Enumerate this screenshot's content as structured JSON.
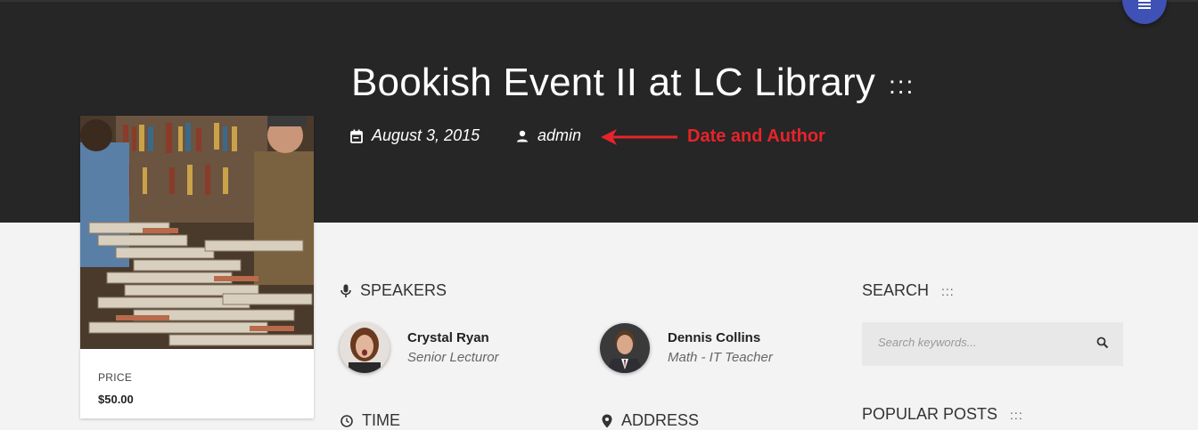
{
  "event": {
    "title": "Bookish Event II at LC Library",
    "title_dots": ":::",
    "date": "August 3, 2015",
    "author": "admin"
  },
  "annotation": {
    "text": "Date and Author",
    "color": "#e8232b"
  },
  "ticket": {
    "price_label": "PRICE",
    "price": "$50.00"
  },
  "speakers": {
    "heading": "SPEAKERS",
    "items": [
      {
        "name": "Crystal Ryan",
        "role": "Senior Lecturor"
      },
      {
        "name": "Dennis Collins",
        "role": "Math - IT Teacher"
      }
    ]
  },
  "time": {
    "heading": "TIME"
  },
  "address": {
    "heading": "ADDRESS"
  },
  "sidebar": {
    "search_heading": "SEARCH",
    "heading_dots": ":::",
    "search_placeholder": "Search keywords...",
    "popular_heading": "POPULAR POSTS"
  },
  "colors": {
    "hero_bg": "#262626",
    "accent_fab": "#3f51b5",
    "page_bg": "#f3f3f3"
  },
  "icons": {
    "menu": "hamburger-icon",
    "date": "calendar-icon",
    "author": "person-icon",
    "speakers": "microphone-icon",
    "time": "clock-icon",
    "address": "location-pin-icon",
    "search": "search-icon"
  }
}
